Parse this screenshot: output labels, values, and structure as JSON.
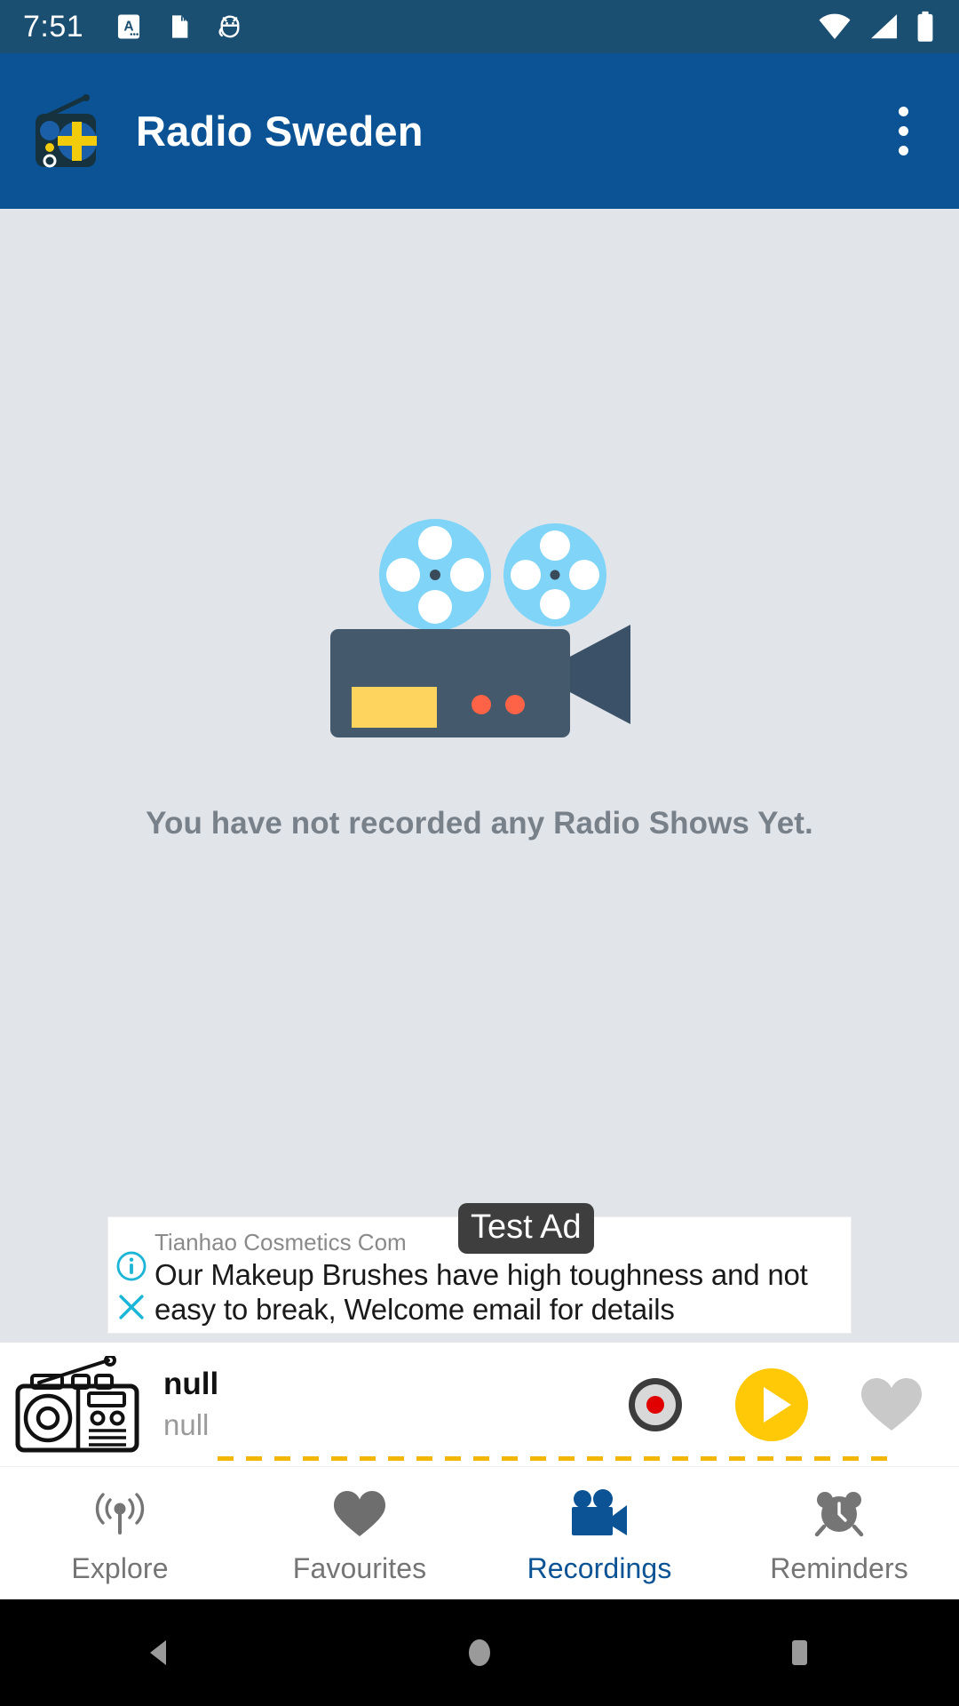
{
  "status_bar": {
    "time": "7:51",
    "left_icons": [
      "document-a-icon",
      "sd-card-icon",
      "android-debug-icon"
    ],
    "right_icons": [
      "wifi-icon",
      "cell-signal-icon",
      "battery-icon"
    ],
    "background": "#1B4F72"
  },
  "app_bar": {
    "title": "Radio Sweden",
    "logo": "radio-sweden-logo",
    "overflow": "overflow-menu-icon",
    "background": "#0B5394"
  },
  "content": {
    "illustration": "video-camera-illustration",
    "empty_message": "You have not recorded any Radio Shows Yet.",
    "background": "#E1E5EA"
  },
  "ad": {
    "advertiser": "Tianhao Cosmetics Com",
    "headline": "Our Makeup Brushes have high toughness and not easy to break, Welcome email for details",
    "badge": "Test Ad",
    "info_icon": "info-icon",
    "close_icon": "close-icon",
    "accent": "#1CB5D6"
  },
  "player": {
    "thumb": "radio-line-icon",
    "title": "null",
    "subtitle": "null",
    "record_button": "record-icon",
    "play_button": "play-icon",
    "favourite_button": "heart-icon",
    "play_color": "#FFC907",
    "progress_color": "#F2B705"
  },
  "bottom_nav": {
    "active_color": "#0B5394",
    "inactive_color": "#757575",
    "items": [
      {
        "label": "Explore",
        "icon": "broadcast-icon",
        "active": false
      },
      {
        "label": "Favourites",
        "icon": "heart-icon",
        "active": false
      },
      {
        "label": "Recordings",
        "icon": "video-camera-icon",
        "active": true
      },
      {
        "label": "Reminders",
        "icon": "alarm-clock-icon",
        "active": false
      }
    ]
  },
  "android_nav": {
    "back": "back-triangle-icon",
    "home": "home-circle-icon",
    "recents": "recents-square-icon"
  }
}
